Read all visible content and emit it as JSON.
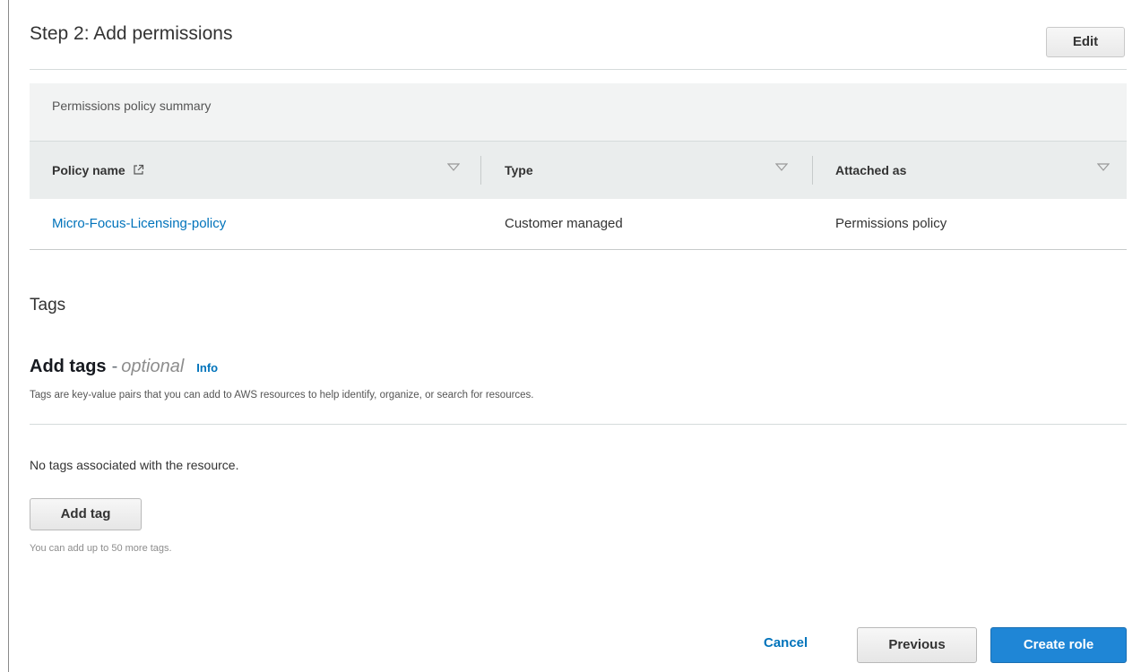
{
  "step": {
    "title": "Step 2: Add permissions",
    "edit_label": "Edit"
  },
  "permissions_summary": {
    "title": "Permissions policy summary",
    "columns": [
      "Policy name",
      "Type",
      "Attached as"
    ],
    "rows": [
      {
        "policy_name": "Micro-Focus-Licensing-policy",
        "type": "Customer managed",
        "attached_as": "Permissions policy"
      }
    ]
  },
  "tags": {
    "heading": "Tags",
    "add_title": "Add tags",
    "separator": "-",
    "optional_label": "optional",
    "info_label": "Info",
    "description": "Tags are key-value pairs that you can add to AWS resources to help identify, organize, or search for resources.",
    "empty_message": "No tags associated with the resource.",
    "add_tag_label": "Add tag",
    "limit_hint": "You can add up to 50 more tags."
  },
  "footer": {
    "cancel_label": "Cancel",
    "previous_label": "Previous",
    "create_label": "Create role"
  },
  "colors": {
    "link": "#0073bb",
    "primary_button": "#1f86d6",
    "header_bg": "#eaeded",
    "panel_bg": "#f2f3f3"
  },
  "icons": {
    "external_link": "external-link-icon",
    "sort": "sort-down-icon"
  }
}
